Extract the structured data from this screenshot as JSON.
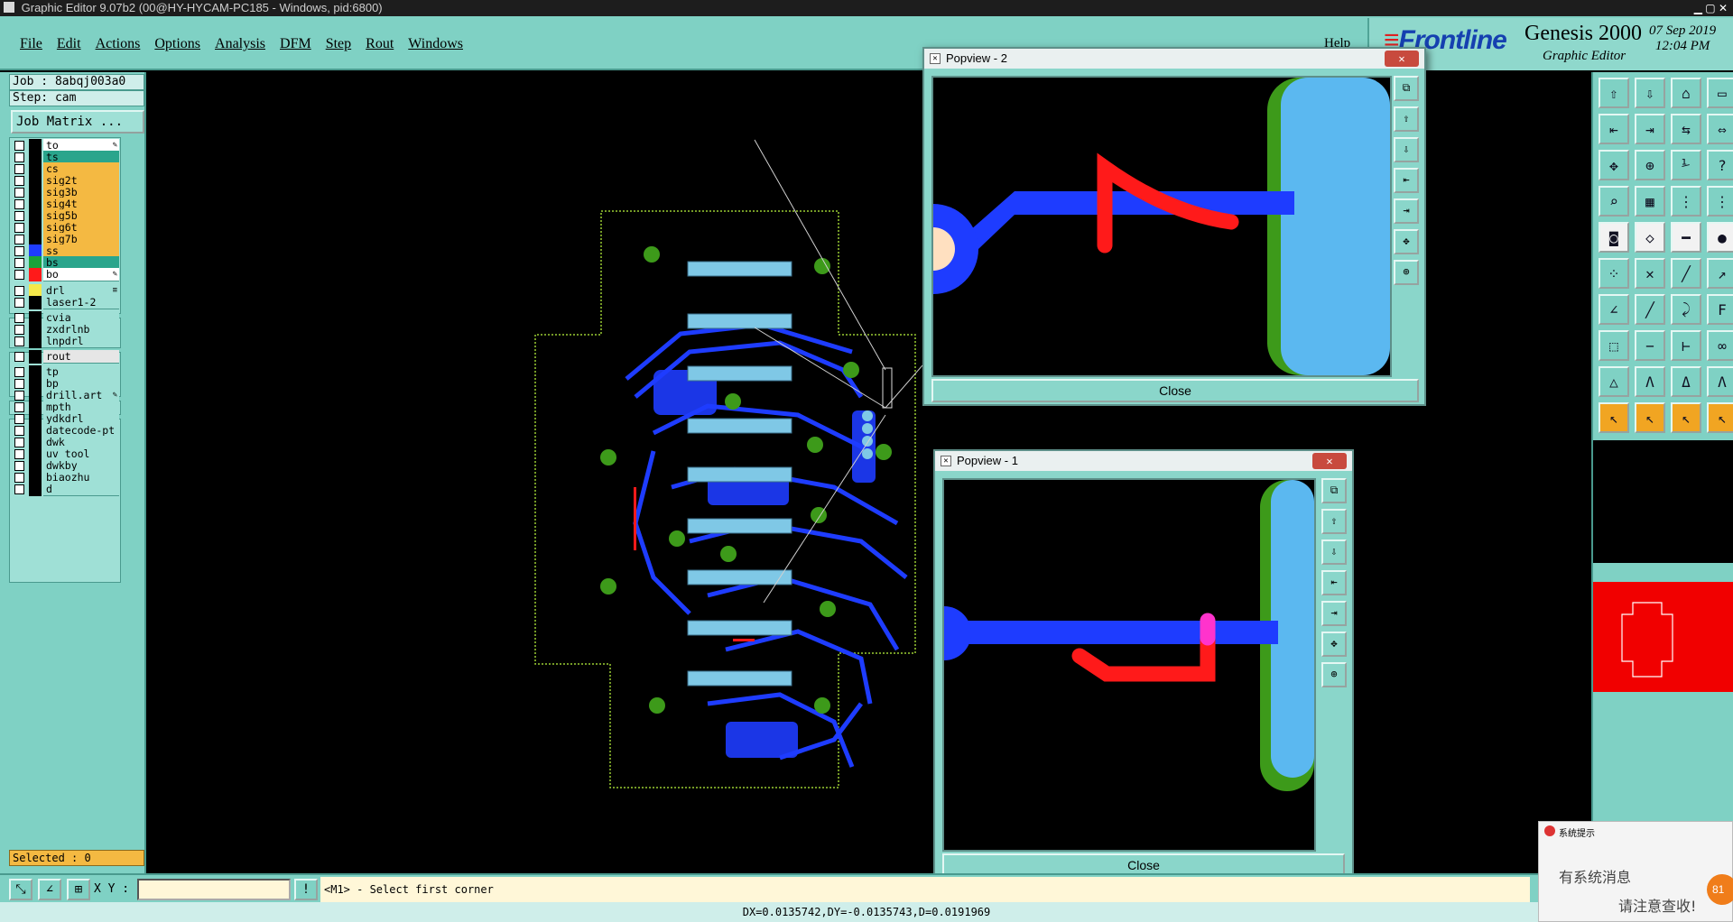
{
  "window": {
    "title": "Graphic Editor 9.07b2 (00@HY-HYCAM-PC185 - Windows, pid:6800)"
  },
  "menu": {
    "items": [
      "File",
      "Edit",
      "Actions",
      "Options",
      "Analysis",
      "DFM",
      "Step",
      "Rout",
      "Windows"
    ],
    "help": "Help"
  },
  "brand": {
    "logo": "Frontline",
    "product": "Genesis 2000",
    "subtitle": "Graphic Editor",
    "date": "07 Sep 2019",
    "time": "12:04 PM"
  },
  "left": {
    "job": "Job : 8abqj003a0",
    "step": "Step: cam",
    "job_matrix": "Job Matrix ...",
    "selected": "Selected : 0"
  },
  "layers": [
    {
      "name": "to",
      "swatch": "#000000",
      "bg": "#ffffff",
      "mark": "✎"
    },
    {
      "name": "ts",
      "swatch": "#000000",
      "bg": "#2aa58c",
      "mark": ""
    },
    {
      "name": "cs",
      "swatch": "#000000",
      "bg": "#f4b942",
      "mark": ""
    },
    {
      "name": "sig2t",
      "swatch": "#000000",
      "bg": "#f4b942",
      "mark": ""
    },
    {
      "name": "sig3b",
      "swatch": "#000000",
      "bg": "#f4b942",
      "mark": ""
    },
    {
      "name": "sig4t",
      "swatch": "#000000",
      "bg": "#f4b942",
      "mark": ""
    },
    {
      "name": "sig5b",
      "swatch": "#000000",
      "bg": "#f4b942",
      "mark": ""
    },
    {
      "name": "sig6t",
      "swatch": "#000000",
      "bg": "#f4b942",
      "mark": ""
    },
    {
      "name": "sig7b",
      "swatch": "#000000",
      "bg": "#f4b942",
      "mark": ""
    },
    {
      "name": "ss",
      "swatch": "#1e3cff",
      "bg": "#f4b942",
      "mark": ""
    },
    {
      "name": "bs",
      "swatch": "#1aa33a",
      "bg": "#2aa58c",
      "mark": ""
    },
    {
      "name": "bo",
      "swatch": "#ff1a1a",
      "bg": "#ffffff",
      "mark": "✎"
    },
    {
      "name": "drl",
      "swatch": "#f5e84a",
      "bg": "#9fe0d6",
      "mark": "≡"
    },
    {
      "name": "laser1-2",
      "swatch": "#000000",
      "bg": "#9fe0d6",
      "mark": ""
    },
    {
      "name": "cvia",
      "swatch": "#000000",
      "bg": "#9fe0d6",
      "mark": ""
    },
    {
      "name": "zxdrlnb",
      "swatch": "#000000",
      "bg": "#9fe0d6",
      "mark": ""
    },
    {
      "name": "lnpdrl",
      "swatch": "#000000",
      "bg": "#9fe0d6",
      "mark": ""
    },
    {
      "name": "rout",
      "swatch": "#000000",
      "bg": "#e6e6e6",
      "mark": ""
    },
    {
      "name": "tp",
      "swatch": "#000000",
      "bg": "#9fe0d6",
      "mark": ""
    },
    {
      "name": "bp",
      "swatch": "#000000",
      "bg": "#9fe0d6",
      "mark": ""
    },
    {
      "name": "drill.art",
      "swatch": "#000000",
      "bg": "#9fe0d6",
      "mark": "✎"
    },
    {
      "name": "mpth",
      "swatch": "#000000",
      "bg": "#9fe0d6",
      "mark": ""
    },
    {
      "name": "ydkdrl",
      "swatch": "#000000",
      "bg": "#9fe0d6",
      "mark": ""
    },
    {
      "name": "datecode-pt",
      "swatch": "#000000",
      "bg": "#9fe0d6",
      "mark": ""
    },
    {
      "name": "dwk",
      "swatch": "#000000",
      "bg": "#9fe0d6",
      "mark": ""
    },
    {
      "name": "uv_tool",
      "swatch": "#000000",
      "bg": "#9fe0d6",
      "mark": ""
    },
    {
      "name": "dwkby",
      "swatch": "#000000",
      "bg": "#9fe0d6",
      "mark": ""
    },
    {
      "name": "biaozhu",
      "swatch": "#000000",
      "bg": "#9fe0d6",
      "mark": ""
    },
    {
      "name": "d",
      "swatch": "#000000",
      "bg": "#9fe0d6",
      "mark": ""
    }
  ],
  "bottom": {
    "xy_label": "X Y :",
    "xy_value": "",
    "prompt": "<M1> - Select first corner",
    "status": "DX=0.0135742,DY=-0.0135743,D=0.0191969"
  },
  "popup2": {
    "title": "Popview - 2",
    "close": "Close",
    "close_x": "✕"
  },
  "popup1": {
    "title": "Popview - 1",
    "close": "Close",
    "close_x": "✕"
  },
  "notify": {
    "title": "系统提示",
    "line1": "有系统消息",
    "line2": "请注意查收!",
    "badge": "81"
  },
  "colors": {
    "panel": "#7fd1c4",
    "copper": "#1e3cff",
    "pad": "#7fc8e6",
    "mask": "#3d9a1a",
    "silk": "#ff1a1a",
    "highlight": "#ff33cc"
  }
}
